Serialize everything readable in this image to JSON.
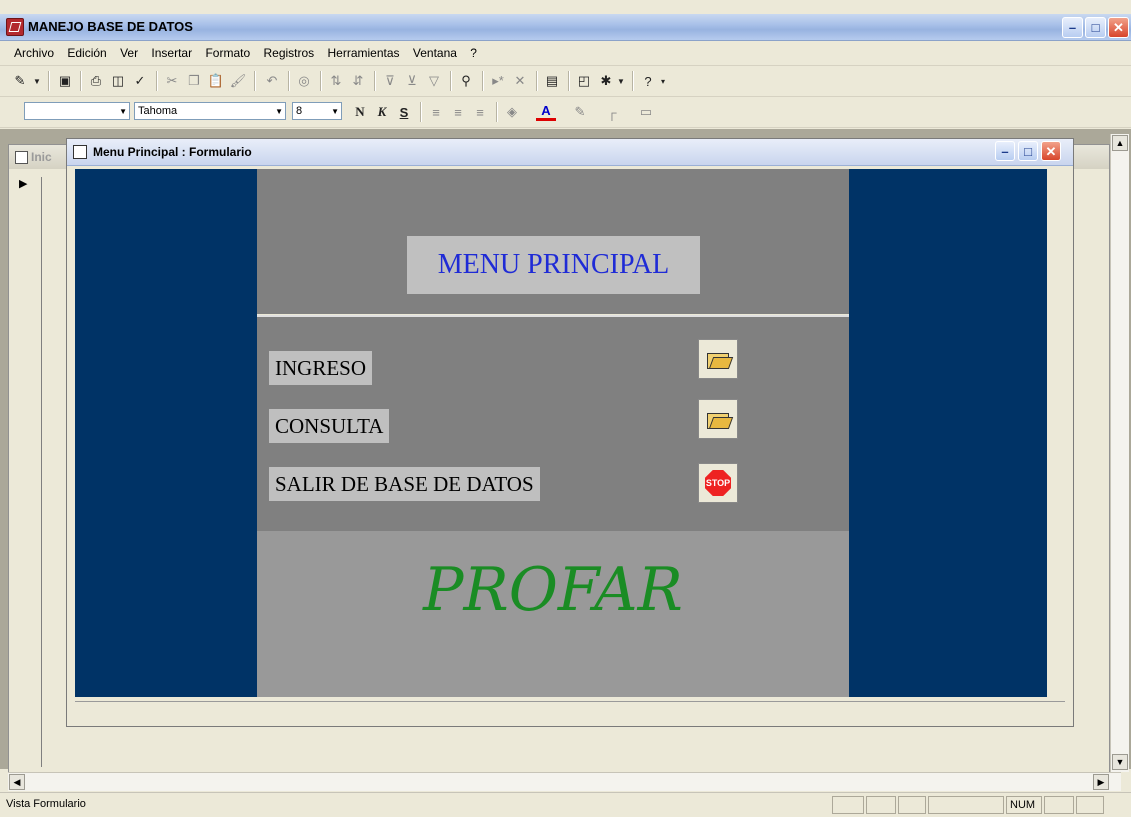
{
  "app": {
    "title": "MANEJO BASE DE DATOS",
    "menu": [
      "Archivo",
      "Edición",
      "Ver",
      "Insertar",
      "Formato",
      "Registros",
      "Herramientas",
      "Ventana",
      "?"
    ]
  },
  "toolbar2": {
    "font_name": "Tahoma",
    "font_size": "8",
    "bold": "N",
    "italic": "K",
    "underline": "S"
  },
  "background_window": {
    "title": "Inic"
  },
  "form_window": {
    "title": "Menu Principal : Formulario",
    "menu_title": "MENU PRINCIPAL",
    "options": [
      {
        "label": "INGRESO",
        "icon": "open-folder-icon"
      },
      {
        "label": "CONSULTA",
        "icon": "open-folder-icon"
      },
      {
        "label": "SALIR DE BASE DE DATOS",
        "icon": "stop-sign-icon"
      }
    ],
    "stop_text": "STOP",
    "footer_text": "PROFAR"
  },
  "status": {
    "text": "Vista Formulario",
    "num": "NUM"
  },
  "colors": {
    "panel_blue": "#003366",
    "title_blue": "#1f2bd6",
    "profar_green": "#1a8c24"
  }
}
